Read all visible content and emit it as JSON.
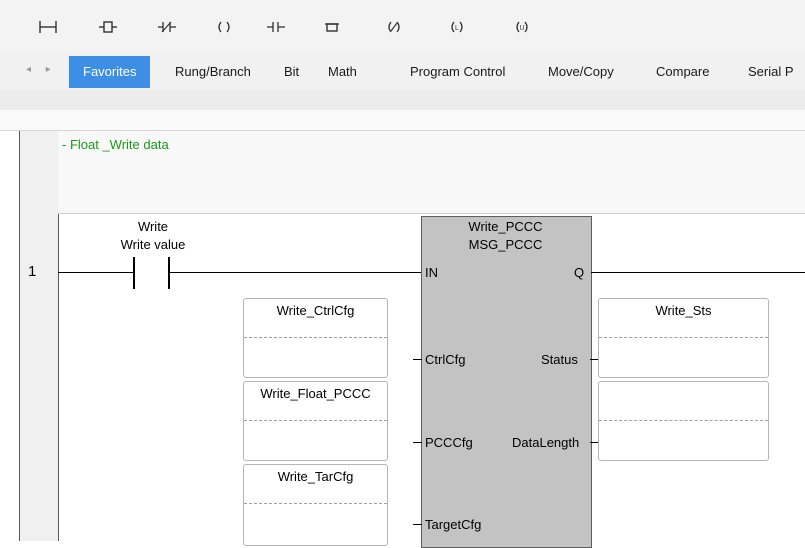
{
  "toolbar": {
    "icons": [
      "contact-icon",
      "rung-icon",
      "branch-icon",
      "coil-icon",
      "contact-parallel-icon",
      "block-icon",
      "negated-coil-icon",
      "latch-coil-icon",
      "unlatch-coil-icon"
    ]
  },
  "tabs": [
    "Favorites",
    "Rung/Branch",
    "Bit",
    "Math",
    "Program Control",
    "Move/Copy",
    "Compare",
    "Serial P"
  ],
  "rung": {
    "comment": "- Float _Write data",
    "number": "1",
    "contact_tag": "Write",
    "contact_desc": "Write value"
  },
  "block": {
    "instance": "Write_PCCC",
    "type": "MSG_PCCC",
    "inputs": [
      "IN",
      "CtrlCfg",
      "PCCCfg",
      "TargetCfg"
    ],
    "outputs": [
      "Q",
      "Status",
      "DataLength"
    ]
  },
  "operands": {
    "ctrlcfg": "Write_CtrlCfg",
    "pccccfg": "Write_Float_PCCC",
    "targetcfg": "Write_TarCfg",
    "status": "Write_Sts",
    "datalength": ""
  }
}
